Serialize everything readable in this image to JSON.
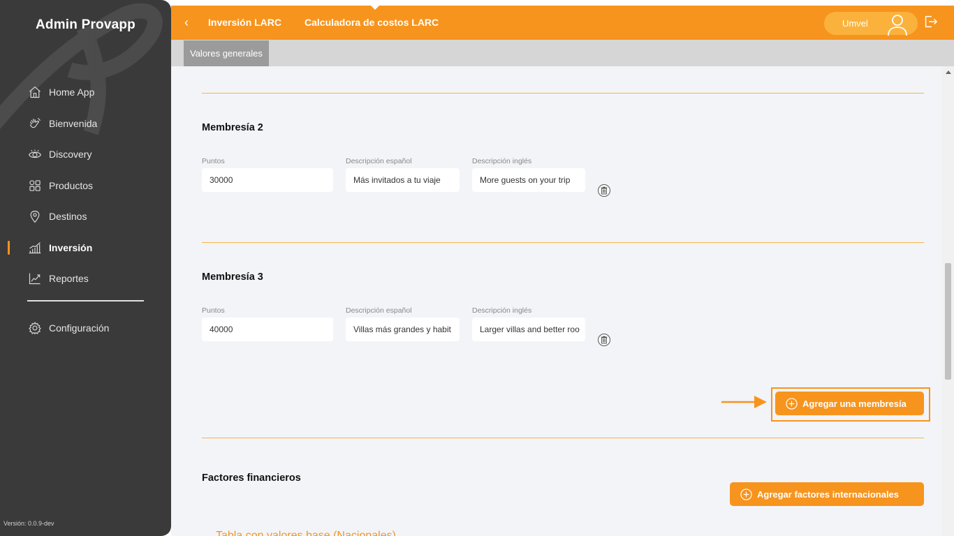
{
  "app": {
    "title": "Admin Provapp",
    "version": "Versión: 0.0.9-dev"
  },
  "sidebar": {
    "items": [
      {
        "label": "Home App",
        "icon": "home-icon"
      },
      {
        "label": "Bienvenida",
        "icon": "hand-wave-icon"
      },
      {
        "label": "Discovery",
        "icon": "eye-icon"
      },
      {
        "label": "Productos",
        "icon": "grid-icon"
      },
      {
        "label": "Destinos",
        "icon": "map-pin-icon"
      },
      {
        "label": "Inversión",
        "icon": "bar-chart-icon",
        "active": true
      },
      {
        "label": "Reportes",
        "icon": "line-chart-icon"
      }
    ],
    "config": {
      "label": "Configuración",
      "icon": "gear-icon"
    }
  },
  "header": {
    "breadcrumb_1": "Inversión LARC",
    "breadcrumb_2": "Calculadora de costos LARC",
    "user_name": "Umvel",
    "accent": "#f7941d"
  },
  "subtabs": {
    "active": "Valores generales"
  },
  "memberships": [
    {
      "title": "Membresía 2",
      "labels": {
        "points": "Puntos",
        "desc_es": "Descripción español",
        "desc_en": "Descripción inglés"
      },
      "points": "30000",
      "desc_es": "Más invitados a tu viaje",
      "desc_en": "More guests on your trip"
    },
    {
      "title": "Membresía 3",
      "labels": {
        "points": "Puntos",
        "desc_es": "Descripción español",
        "desc_en": "Descripción inglés"
      },
      "points": "40000",
      "desc_es": "Villas más grandes y habit",
      "desc_en": "Larger villas and better roo"
    }
  ],
  "buttons": {
    "add_membership": "Agregar una membresía",
    "add_international_factors": "Agregar factores internacionales"
  },
  "financial": {
    "title": "Factores financieros",
    "partial_link": "Tabla con valores base (Nacionales)"
  }
}
